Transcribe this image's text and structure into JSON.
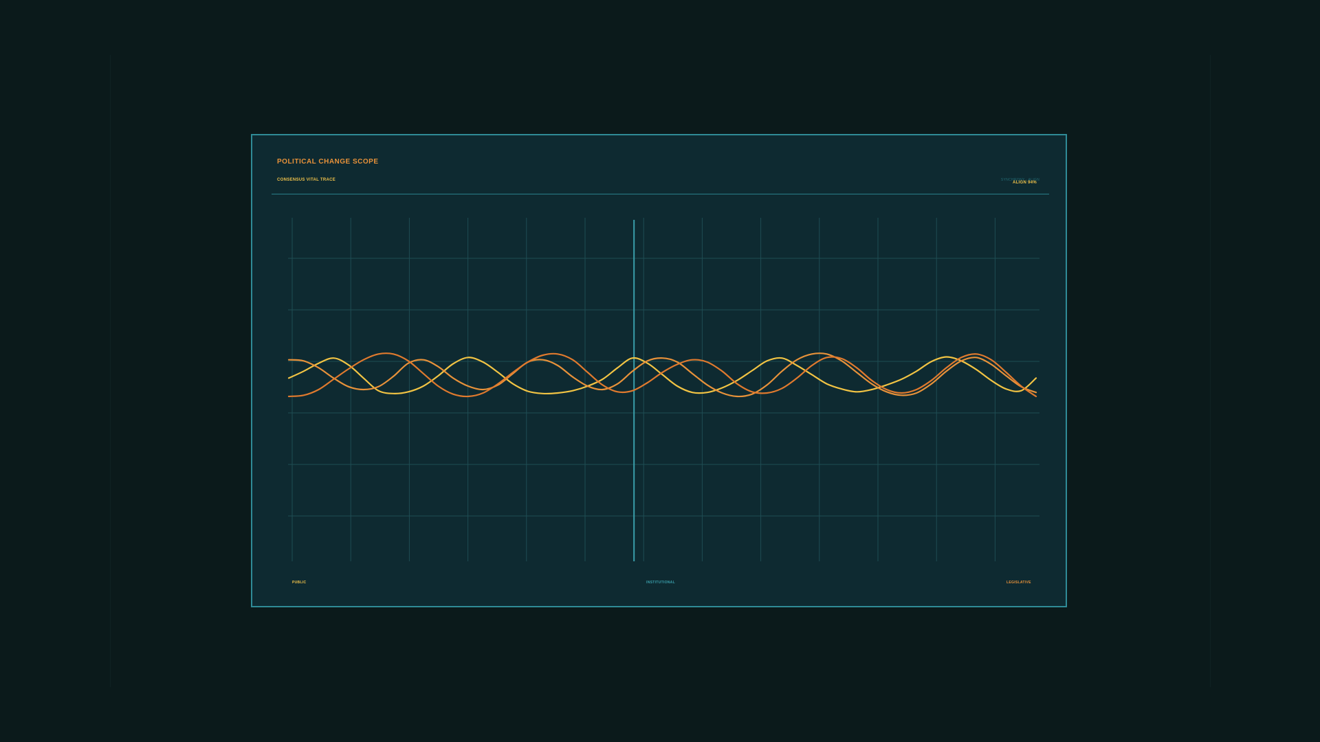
{
  "panel": {
    "title": "POLITICAL CHANGE SCOPE",
    "subtitle": "CONSENSUS VITAL TRACE",
    "readout_faint": "SYNCHRONY · ALIGN",
    "readout": "ALIGN 94%"
  },
  "colors": {
    "background": "#0b1a1b",
    "panel": "#0e2a31",
    "border": "#2f8b97",
    "grid": "#1f4d54",
    "accent_orange": "#e8923a",
    "accent_yellow": "#f2c444",
    "cursor": "#3a9fab"
  },
  "chart_data": {
    "type": "line",
    "title": "POLITICAL CHANGE SCOPE",
    "subtitle": "CONSENSUS VITAL TRACE",
    "xlim": [
      0,
      1
    ],
    "ylim": [
      -3,
      3
    ],
    "y_ticks": [
      "",
      "",
      "",
      "",
      "",
      ""
    ],
    "cursor_x": 0.462,
    "grid": true,
    "region_labels": [
      {
        "label": "PUBLIC",
        "color": "#f0c24a",
        "align": "left"
      },
      {
        "label": "INSTITUTIONAL",
        "color": "#3a9fab",
        "align": "center"
      },
      {
        "label": "LEGISLATIVE",
        "color": "#e8923a",
        "align": "right"
      }
    ],
    "series": [
      {
        "color": "#f2c444",
        "points": [
          [
            0.0,
            0.2
          ],
          [
            0.02,
            0.32
          ],
          [
            0.04,
            0.46
          ],
          [
            0.06,
            0.55
          ],
          [
            0.08,
            0.43
          ],
          [
            0.1,
            0.2
          ],
          [
            0.12,
            -0.02
          ],
          [
            0.14,
            -0.07
          ],
          [
            0.16,
            -0.04
          ],
          [
            0.18,
            0.06
          ],
          [
            0.2,
            0.24
          ],
          [
            0.22,
            0.45
          ],
          [
            0.24,
            0.56
          ],
          [
            0.26,
            0.48
          ],
          [
            0.28,
            0.3
          ],
          [
            0.3,
            0.1
          ],
          [
            0.32,
            -0.03
          ],
          [
            0.34,
            -0.07
          ],
          [
            0.36,
            -0.06
          ],
          [
            0.38,
            -0.02
          ],
          [
            0.4,
            0.06
          ],
          [
            0.42,
            0.18
          ],
          [
            0.44,
            0.38
          ],
          [
            0.46,
            0.55
          ],
          [
            0.48,
            0.46
          ],
          [
            0.5,
            0.26
          ],
          [
            0.52,
            0.06
          ],
          [
            0.54,
            -0.05
          ],
          [
            0.56,
            -0.05
          ],
          [
            0.58,
            0.03
          ],
          [
            0.6,
            0.16
          ],
          [
            0.62,
            0.33
          ],
          [
            0.64,
            0.5
          ],
          [
            0.66,
            0.55
          ],
          [
            0.68,
            0.42
          ],
          [
            0.7,
            0.26
          ],
          [
            0.72,
            0.1
          ],
          [
            0.74,
            0.01
          ],
          [
            0.76,
            -0.04
          ],
          [
            0.78,
            0.0
          ],
          [
            0.8,
            0.08
          ],
          [
            0.82,
            0.18
          ],
          [
            0.84,
            0.32
          ],
          [
            0.86,
            0.49
          ],
          [
            0.88,
            0.57
          ],
          [
            0.9,
            0.5
          ],
          [
            0.92,
            0.35
          ],
          [
            0.94,
            0.16
          ],
          [
            0.96,
            0.01
          ],
          [
            0.98,
            -0.02
          ],
          [
            1.0,
            0.2
          ]
        ]
      },
      {
        "color": "#e8923a",
        "points": [
          [
            0.0,
            0.52
          ],
          [
            0.02,
            0.5
          ],
          [
            0.04,
            0.38
          ],
          [
            0.06,
            0.2
          ],
          [
            0.08,
            0.05
          ],
          [
            0.1,
            0.0
          ],
          [
            0.12,
            0.05
          ],
          [
            0.14,
            0.23
          ],
          [
            0.16,
            0.46
          ],
          [
            0.18,
            0.52
          ],
          [
            0.2,
            0.4
          ],
          [
            0.22,
            0.2
          ],
          [
            0.24,
            0.06
          ],
          [
            0.26,
            0.0
          ],
          [
            0.28,
            0.08
          ],
          [
            0.3,
            0.28
          ],
          [
            0.32,
            0.48
          ],
          [
            0.34,
            0.52
          ],
          [
            0.36,
            0.42
          ],
          [
            0.38,
            0.22
          ],
          [
            0.4,
            0.06
          ],
          [
            0.42,
            0.0
          ],
          [
            0.44,
            0.1
          ],
          [
            0.46,
            0.32
          ],
          [
            0.48,
            0.5
          ],
          [
            0.5,
            0.55
          ],
          [
            0.52,
            0.48
          ],
          [
            0.54,
            0.28
          ],
          [
            0.56,
            0.08
          ],
          [
            0.58,
            -0.06
          ],
          [
            0.6,
            -0.12
          ],
          [
            0.62,
            -0.08
          ],
          [
            0.64,
            0.08
          ],
          [
            0.66,
            0.32
          ],
          [
            0.68,
            0.52
          ],
          [
            0.7,
            0.62
          ],
          [
            0.72,
            0.62
          ],
          [
            0.74,
            0.5
          ],
          [
            0.76,
            0.3
          ],
          [
            0.78,
            0.1
          ],
          [
            0.8,
            -0.04
          ],
          [
            0.82,
            -0.1
          ],
          [
            0.84,
            -0.06
          ],
          [
            0.86,
            0.1
          ],
          [
            0.88,
            0.32
          ],
          [
            0.9,
            0.5
          ],
          [
            0.92,
            0.56
          ],
          [
            0.94,
            0.44
          ],
          [
            0.96,
            0.24
          ],
          [
            0.98,
            0.05
          ],
          [
            1.0,
            -0.05
          ]
        ]
      },
      {
        "color": "#e07a2e",
        "points": [
          [
            0.0,
            -0.12
          ],
          [
            0.02,
            -0.1
          ],
          [
            0.04,
            0.0
          ],
          [
            0.06,
            0.18
          ],
          [
            0.08,
            0.36
          ],
          [
            0.1,
            0.52
          ],
          [
            0.12,
            0.62
          ],
          [
            0.14,
            0.62
          ],
          [
            0.16,
            0.5
          ],
          [
            0.18,
            0.28
          ],
          [
            0.2,
            0.06
          ],
          [
            0.22,
            -0.08
          ],
          [
            0.24,
            -0.12
          ],
          [
            0.26,
            -0.06
          ],
          [
            0.28,
            0.1
          ],
          [
            0.3,
            0.3
          ],
          [
            0.32,
            0.48
          ],
          [
            0.34,
            0.6
          ],
          [
            0.36,
            0.62
          ],
          [
            0.38,
            0.52
          ],
          [
            0.4,
            0.3
          ],
          [
            0.42,
            0.08
          ],
          [
            0.44,
            -0.04
          ],
          [
            0.46,
            -0.02
          ],
          [
            0.48,
            0.12
          ],
          [
            0.5,
            0.3
          ],
          [
            0.52,
            0.44
          ],
          [
            0.54,
            0.52
          ],
          [
            0.56,
            0.48
          ],
          [
            0.58,
            0.32
          ],
          [
            0.6,
            0.1
          ],
          [
            0.62,
            -0.04
          ],
          [
            0.64,
            -0.06
          ],
          [
            0.66,
            0.02
          ],
          [
            0.68,
            0.2
          ],
          [
            0.7,
            0.42
          ],
          [
            0.72,
            0.56
          ],
          [
            0.74,
            0.54
          ],
          [
            0.76,
            0.38
          ],
          [
            0.78,
            0.16
          ],
          [
            0.8,
            0.0
          ],
          [
            0.82,
            -0.06
          ],
          [
            0.84,
            0.0
          ],
          [
            0.86,
            0.16
          ],
          [
            0.88,
            0.38
          ],
          [
            0.9,
            0.56
          ],
          [
            0.92,
            0.62
          ],
          [
            0.94,
            0.52
          ],
          [
            0.96,
            0.3
          ],
          [
            0.98,
            0.06
          ],
          [
            1.0,
            -0.12
          ]
        ]
      }
    ]
  }
}
